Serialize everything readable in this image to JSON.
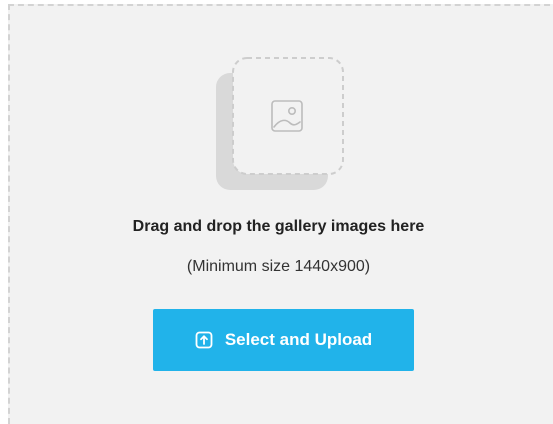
{
  "dropzone": {
    "heading": "Drag and drop the gallery images here",
    "subheading": "(Minimum size 1440x900)",
    "illustration_icon": "image-placeholder-icon",
    "upload_button": {
      "label": "Select and Upload",
      "icon": "upload-icon"
    }
  },
  "colors": {
    "background": "#f2f2f2",
    "dashed_border": "#d3d3d3",
    "button": "#21b3ea",
    "button_text": "#ffffff",
    "heading_text": "#222222"
  }
}
